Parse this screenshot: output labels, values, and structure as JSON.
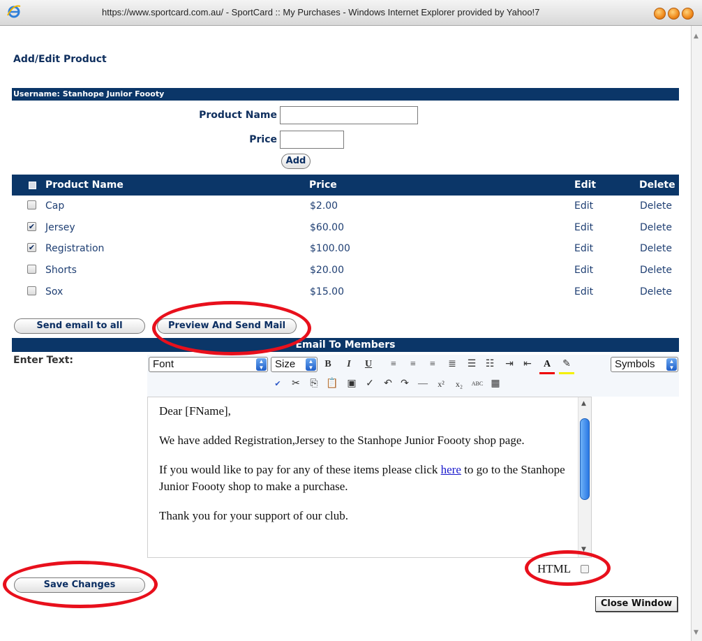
{
  "window": {
    "title": "https://www.sportcard.com.au/ - SportCard :: My Purchases - Windows Internet Explorer provided by Yahoo!7"
  },
  "page": {
    "heading": "Add/Edit Product",
    "username_bar": "Username: Stanhope Junior Foooty"
  },
  "form": {
    "product_name_label": "Product Name",
    "product_name_value": "",
    "price_label": "Price",
    "price_value": "",
    "add_button": "Add"
  },
  "table": {
    "headers": {
      "name": "Product Name",
      "price": "Price",
      "edit": "Edit",
      "delete": "Delete"
    },
    "rows": [
      {
        "name": "Cap",
        "price": "$2.00",
        "edit": "Edit",
        "delete": "Delete",
        "checked": false
      },
      {
        "name": "Jersey",
        "price": "$60.00",
        "edit": "Edit",
        "delete": "Delete",
        "checked": true
      },
      {
        "name": "Registration",
        "price": "$100.00",
        "edit": "Edit",
        "delete": "Delete",
        "checked": true
      },
      {
        "name": "Shorts",
        "price": "$20.00",
        "edit": "Edit",
        "delete": "Delete",
        "checked": false
      },
      {
        "name": "Sox",
        "price": "$15.00",
        "edit": "Edit",
        "delete": "Delete",
        "checked": false
      }
    ]
  },
  "actions": {
    "send_email_all": "Send email to all",
    "preview_send": "Preview And Send Mail"
  },
  "email": {
    "section_title": "Email To Members",
    "enter_text_label": "Enter Text:",
    "font_select": "Font",
    "size_select": "Size",
    "symbols_select": "Symbols",
    "body": {
      "greeting": "Dear [FName],",
      "para1": "We have added Registration,Jersey to the Stanhope Junior Foooty shop page.",
      "para2_before": "If you would like to pay for any of these items please click ",
      "para2_link": "here",
      "para2_after": " to go to the Stanhope Junior Foooty shop to make a purchase.",
      "para3": "Thank you for your support of our club."
    },
    "html_toggle_label": "HTML"
  },
  "footer": {
    "save_changes": "Save Changes",
    "close_window": "Close Window"
  },
  "colors": {
    "header_bar": "#0b3668",
    "annotation_red": "#e8101c",
    "link_text": "#1f3f73"
  }
}
